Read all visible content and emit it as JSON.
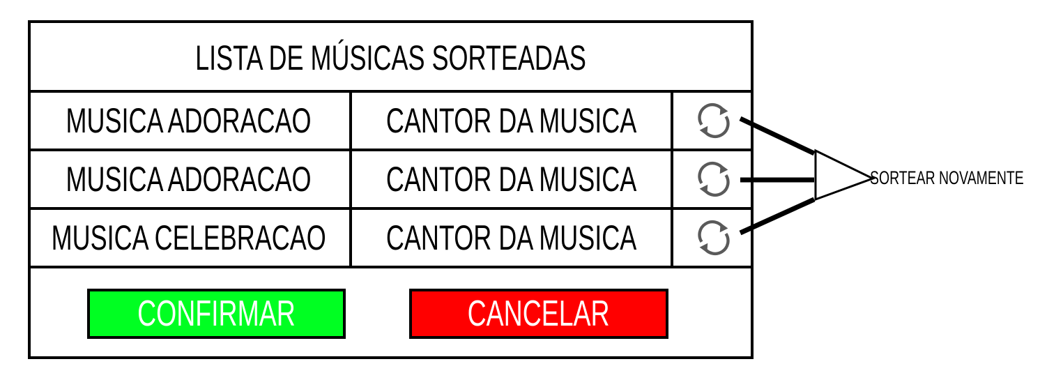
{
  "dialog": {
    "title": "LISTA DE MÚSICAS SORTEADAS",
    "rows": [
      {
        "song": "MUSICA ADORACAO",
        "singer": "CANTOR DA MUSICA",
        "icon": "refresh-icon"
      },
      {
        "song": "MUSICA ADORACAO",
        "singer": "CANTOR DA MUSICA",
        "icon": "refresh-icon"
      },
      {
        "song": "MUSICA CELEBRACAO",
        "singer": "CANTOR DA MUSICA",
        "icon": "refresh-icon"
      }
    ],
    "confirm_label": "CONFIRMAR",
    "cancel_label": "CANCELAR"
  },
  "annotation": {
    "label": "SORTEAR NOVAMENTE"
  },
  "colors": {
    "confirm": "#00ff22",
    "cancel": "#ff0000",
    "icon": "#5a5a5a",
    "border": "#000000"
  }
}
